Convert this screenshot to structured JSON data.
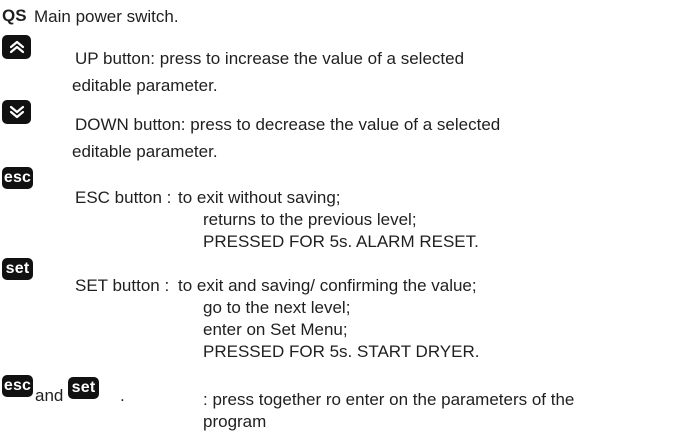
{
  "qs": {
    "label": "QS",
    "text": "Main power switch."
  },
  "up": {
    "icon": "double-chevron-up-icon",
    "line1": "UP button: press to increase the value of a selected",
    "line2": "editable parameter."
  },
  "down": {
    "icon": "double-chevron-down-icon",
    "line1": "DOWN button: press to decrease the value of a selected",
    "line2": "editable parameter."
  },
  "esc": {
    "key_label": "esc",
    "label": "ESC button :",
    "lines": [
      "to exit without saving;",
      "returns to the previous level;",
      "PRESSED FOR 5s. ALARM RESET."
    ]
  },
  "set": {
    "key_label": "set",
    "label": "SET button :",
    "lines": [
      "to exit and saving/ confirming the value;",
      "go to the next level;",
      "enter on Set Menu;",
      "PRESSED FOR 5s. START DRYER."
    ]
  },
  "combo": {
    "key1": "esc",
    "and_text": "and",
    "key2": "set",
    "period": ".",
    "line1": ": press together ro enter on the parameters of the",
    "line2": "program"
  },
  "colors": {
    "key_background": "#111111",
    "key_text": "#ffffff",
    "body_text": "#1f1f1f"
  }
}
